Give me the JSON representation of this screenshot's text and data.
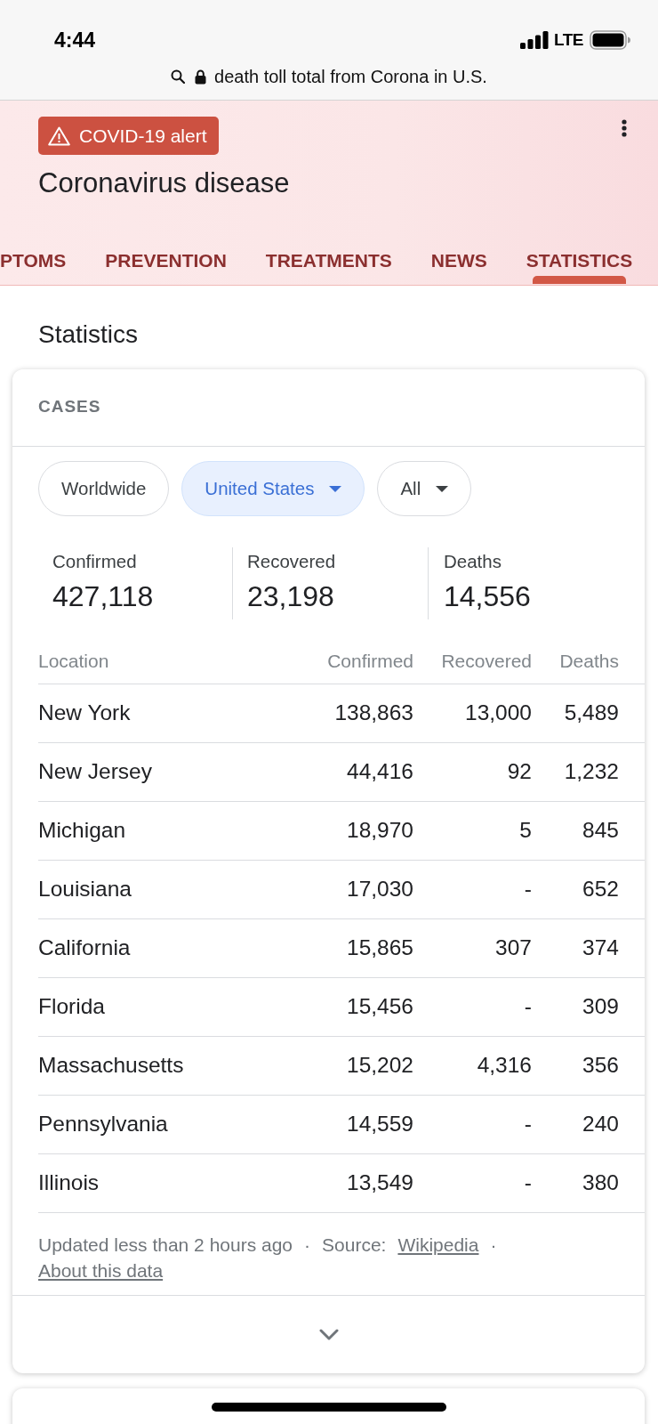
{
  "status_bar": {
    "time": "4:44",
    "network": "LTE"
  },
  "address_bar": {
    "query": "death toll total from Corona in U.S."
  },
  "header": {
    "alert": "COVID-19 alert",
    "title": "Coronavirus disease",
    "tabs": [
      {
        "label": "PTOMS",
        "selected": false
      },
      {
        "label": "PREVENTION",
        "selected": false
      },
      {
        "label": "TREATMENTS",
        "selected": false
      },
      {
        "label": "NEWS",
        "selected": false
      },
      {
        "label": "STATISTICS",
        "selected": true
      }
    ]
  },
  "section_title": "Statistics",
  "cases_card": {
    "title": "CASES",
    "filters": [
      {
        "label": "Worldwide",
        "selected": false,
        "dropdown": false
      },
      {
        "label": "United States",
        "selected": true,
        "dropdown": true
      },
      {
        "label": "All",
        "selected": false,
        "dropdown": true
      }
    ],
    "totals": [
      {
        "label": "Confirmed",
        "value": "427,118"
      },
      {
        "label": "Recovered",
        "value": "23,198"
      },
      {
        "label": "Deaths",
        "value": "14,556"
      }
    ],
    "table": {
      "columns": [
        "Location",
        "Confirmed",
        "Recovered",
        "Deaths"
      ],
      "rows": [
        [
          "New York",
          "138,863",
          "13,000",
          "5,489"
        ],
        [
          "New Jersey",
          "44,416",
          "92",
          "1,232"
        ],
        [
          "Michigan",
          "18,970",
          "5",
          "845"
        ],
        [
          "Louisiana",
          "17,030",
          "-",
          "652"
        ],
        [
          "California",
          "15,865",
          "307",
          "374"
        ],
        [
          "Florida",
          "15,456",
          "-",
          "309"
        ],
        [
          "Massachusetts",
          "15,202",
          "4,316",
          "356"
        ],
        [
          "Pennsylvania",
          "14,559",
          "-",
          "240"
        ],
        [
          "Illinois",
          "13,549",
          "-",
          "380"
        ]
      ]
    },
    "footer": {
      "lines": [
        [
          {
            "kind": "text",
            "text": "Updated less than 2 hours ago"
          },
          {
            "kind": "separator",
            "text": "·"
          },
          {
            "kind": "text",
            "text": "Source:"
          },
          {
            "kind": "link",
            "text": "Wikipedia"
          },
          {
            "kind": "separator",
            "text": "·"
          }
        ],
        [
          {
            "kind": "link",
            "text": "About this data"
          }
        ]
      ]
    }
  }
}
